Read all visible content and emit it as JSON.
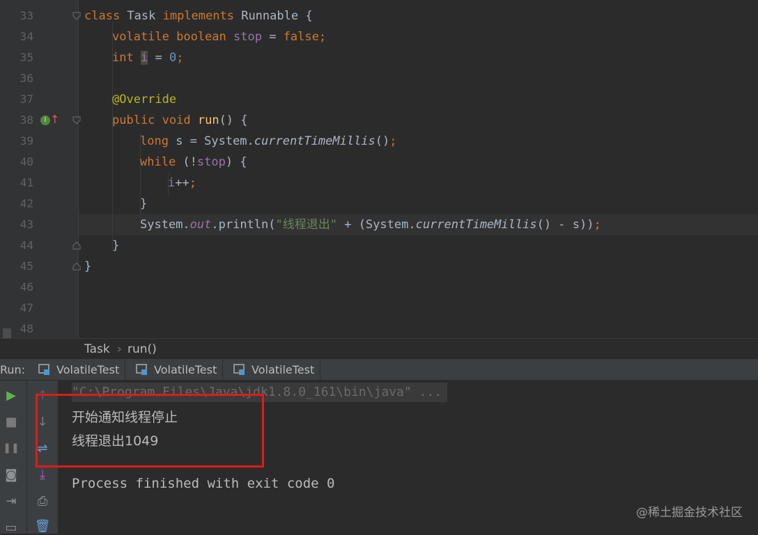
{
  "editor": {
    "line_numbers": [
      "33",
      "34",
      "35",
      "36",
      "37",
      "38",
      "39",
      "40",
      "41",
      "42",
      "43",
      "44",
      "45",
      "46",
      "47",
      "48"
    ],
    "code": {
      "l33": {
        "kw1": "class",
        "name": " Task ",
        "kw2": "implements",
        "rest": " Runnable {"
      },
      "l34": {
        "kw1": "volatile boolean",
        "sp": " ",
        "field": "stop",
        "eq": " = ",
        "kw2": "false",
        "semi": ";"
      },
      "l35": {
        "kw": "int",
        "sp": " ",
        "var": "i",
        "eq": " = ",
        "num": "0",
        "semi": ";"
      },
      "l37": {
        "ann": "@Override"
      },
      "l38": {
        "kw": "public void",
        "sp": " ",
        "fn": "run",
        "rest": "() {"
      },
      "l39": {
        "kw": "long",
        "pre": " s = System.",
        "it": "currentTimeMillis",
        "rest": "()",
        "semi": ";"
      },
      "l40": {
        "kw": "while",
        "pre": " (!",
        "field": "stop",
        "rest": ") {"
      },
      "l41": {
        "var": "i",
        "rest": "++",
        "semi": ";"
      },
      "l42": {
        "text": "}"
      },
      "l43": {
        "pre": "System.",
        "out": "out",
        "mid": ".println(",
        "str": "\"线程退出\"",
        "mid2": " + (System.",
        "it": "currentTimeMillis",
        "rest": "() - s))",
        "semi": ";"
      },
      "l44": {
        "text": "}"
      },
      "l45": {
        "text": "}"
      }
    }
  },
  "breadcrumb": {
    "class": "Task",
    "method": "run()",
    "sep": "›"
  },
  "run_panel": {
    "label": "Run:",
    "tabs": [
      "VolatileTest",
      "VolatileTest",
      "VolatileTest"
    ],
    "console": {
      "command": "\"C:\\Program Files\\Java\\jdk1.8.0_161\\bin\\java\" ...",
      "output": [
        "开始通知线程停止",
        "线程退出1049"
      ],
      "finished": "Process finished with exit code 0"
    }
  },
  "icons": {
    "implements": "I",
    "up": "↑",
    "run": "▶",
    "stop": "■",
    "pause": "❚❚",
    "camera": "◙",
    "login": "⇥",
    "up_arrow": "↑",
    "down_arrow": "↓",
    "wrap": "⇌",
    "scroll_end": "⤓",
    "print": "⎙",
    "trash": "🗑",
    "layout": "▭"
  },
  "watermark": "@稀土掘金技术社区",
  "colors": {
    "keyword": "#cc7832",
    "field": "#9876aa",
    "number": "#6897bb",
    "annotation": "#bbb529",
    "function": "#ffc66d",
    "string": "#6a8759",
    "highlight_box": "#e01b1b"
  }
}
